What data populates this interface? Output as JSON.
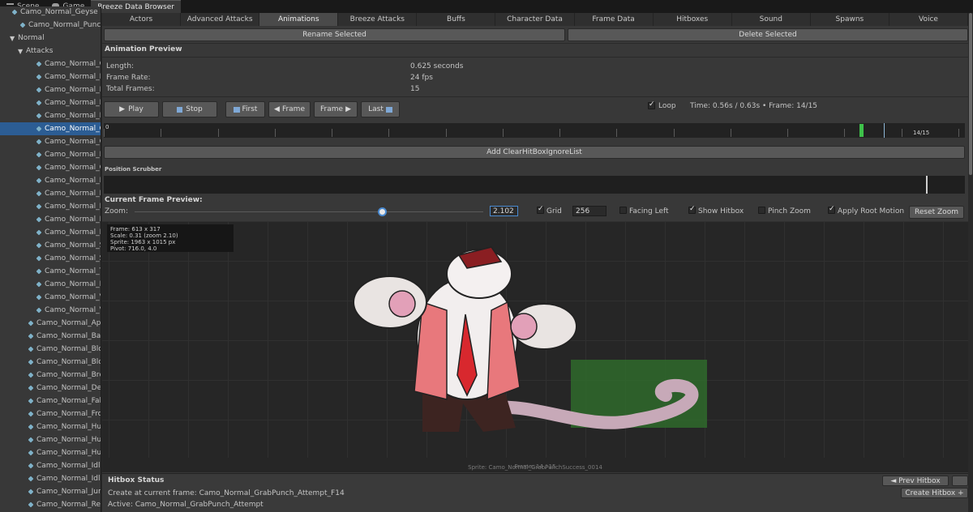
{
  "editor_tabs": [
    {
      "label": "Scene",
      "icon": "scene-icon"
    },
    {
      "label": "Game",
      "icon": "game-icon"
    },
    {
      "label": "Breeze Data Browser",
      "icon": ""
    }
  ],
  "hierarchy": {
    "rows": [
      {
        "label": "Camo_Normal_Geyse",
        "type": "asset"
      },
      {
        "label": "Camo_Normal_Punch",
        "type": "asset"
      },
      {
        "label": "Normal",
        "type": "folder"
      },
      {
        "label": "Attacks",
        "type": "folder"
      },
      {
        "label": "Camo_Normal_G",
        "type": "asset"
      },
      {
        "label": "Camo_Normal_I",
        "type": "asset"
      },
      {
        "label": "Camo_Normal_I",
        "type": "asset"
      },
      {
        "label": "Camo_Normal_I",
        "type": "asset"
      },
      {
        "label": "Camo_Normal_I",
        "type": "asset"
      },
      {
        "label": "Camo_Normal_G",
        "type": "asset",
        "selected": true
      },
      {
        "label": "Camo_Normal_G",
        "type": "asset"
      },
      {
        "label": "Camo_Normal_I",
        "type": "asset"
      },
      {
        "label": "Camo_Normal_G",
        "type": "asset"
      },
      {
        "label": "Camo_Normal_I",
        "type": "asset"
      },
      {
        "label": "Camo_Normal_I",
        "type": "asset"
      },
      {
        "label": "Camo_Normal_I",
        "type": "asset"
      },
      {
        "label": "Camo_Normal_I",
        "type": "asset"
      },
      {
        "label": "Camo_Normal_I",
        "type": "asset"
      },
      {
        "label": "Camo_Normal_S",
        "type": "asset"
      },
      {
        "label": "Camo_Normal_S",
        "type": "asset"
      },
      {
        "label": "Camo_Normal_T",
        "type": "asset"
      },
      {
        "label": "Camo_Normal_I",
        "type": "asset"
      },
      {
        "label": "Camo_Normal_V",
        "type": "asset"
      },
      {
        "label": "Camo_Normal_V",
        "type": "asset"
      },
      {
        "label": "Camo_Normal_App",
        "type": "asset"
      },
      {
        "label": "Camo_Normal_Bac",
        "type": "asset"
      },
      {
        "label": "Camo_Normal_Blo",
        "type": "asset"
      },
      {
        "label": "Camo_Normal_Blo",
        "type": "asset"
      },
      {
        "label": "Camo_Normal_Bre",
        "type": "asset"
      },
      {
        "label": "Camo_Normal_De",
        "type": "asset"
      },
      {
        "label": "Camo_Normal_Fal",
        "type": "asset"
      },
      {
        "label": "Camo_Normal_Fro",
        "type": "asset"
      },
      {
        "label": "Camo_Normal_Hu",
        "type": "asset"
      },
      {
        "label": "Camo_Normal_Hu",
        "type": "asset"
      },
      {
        "label": "Camo_Normal_Hu",
        "type": "asset"
      },
      {
        "label": "Camo_Normal_Idle",
        "type": "asset"
      },
      {
        "label": "Camo_Normal_Idle",
        "type": "asset"
      },
      {
        "label": "Camo_Normal_Jur",
        "type": "asset"
      },
      {
        "label": "Camo_Normal_Rec",
        "type": "asset"
      }
    ]
  },
  "tabs": [
    "Actors",
    "Advanced Attacks",
    "Animations",
    "Breeze Attacks",
    "Buffs",
    "Character Data",
    "Frame Data",
    "Hitboxes",
    "Sound",
    "Spawns",
    "Voice"
  ],
  "active_tab": "Animations",
  "actions": {
    "rename": "Rename Selected",
    "delete": "Delete Selected"
  },
  "animation_preview": {
    "title": "Animation Preview",
    "length_label": "Length:",
    "length_value": "0.625 seconds",
    "rate_label": "Frame Rate:",
    "rate_value": "24 fps",
    "frames_label": "Total Frames:",
    "frames_value": "15"
  },
  "playback": {
    "play": "Play",
    "stop": "Stop",
    "first": "First",
    "prev": "Frame",
    "next": "Frame",
    "last": "Last",
    "loop_label": "Loop",
    "loop_checked": true,
    "status": "Time: 0.56s / 0.63s  •  Frame: 14/15"
  },
  "timeline": {
    "start_label": "0",
    "end_label": "14/15",
    "current_frame": 14,
    "total_frames": 15
  },
  "add_button": "Add ClearHitBoxIgnoreList",
  "scrubber": {
    "title": "Position Scrubber",
    "position": 0.955
  },
  "frame_preview": {
    "title": "Current Frame Preview:",
    "zoom_label": "Zoom:",
    "zoom_value": "2.102",
    "zoom_fraction": 0.71,
    "grid_label": "Grid",
    "grid_checked": true,
    "grid_size": "256",
    "facing_left_label": "Facing Left",
    "facing_left_checked": false,
    "show_hitbox_label": "Show Hitbox",
    "show_hitbox_checked": true,
    "pinch_zoom_label": "Pinch Zoom",
    "pinch_zoom_checked": false,
    "root_motion_label": "Apply Root Motion",
    "root_motion_checked": true,
    "reset_zoom": "Reset Zoom"
  },
  "frame_info": {
    "frame": "Frame: 613 x 317",
    "scale": "Scale: 0.31 (zoom 2.10)",
    "sprite": "Sprite: 1963 x 1015 px",
    "pivot": "Pivot: 716.0, 4.0"
  },
  "sprite_caption": "Sprite: Camo_Normal_GrabPunchSuccess_0014",
  "frame_caption": "Frame: 14 / 15",
  "hitbox_status": {
    "title": "Hitbox Status",
    "create_line": "Create at current frame: Camo_Normal_GrabPunch_Attempt_F14",
    "active_line": "Active: Camo_Normal_GrabPunch_Attempt",
    "prev_hitbox": "◄ Prev Hitbox",
    "create_hitbox": "Create Hitbox +"
  },
  "colors": {
    "selection": "#2c5d94",
    "keyframe": "#3ec14a",
    "hitbox": "#2f6a2c",
    "accent": "#4a8ad0"
  }
}
